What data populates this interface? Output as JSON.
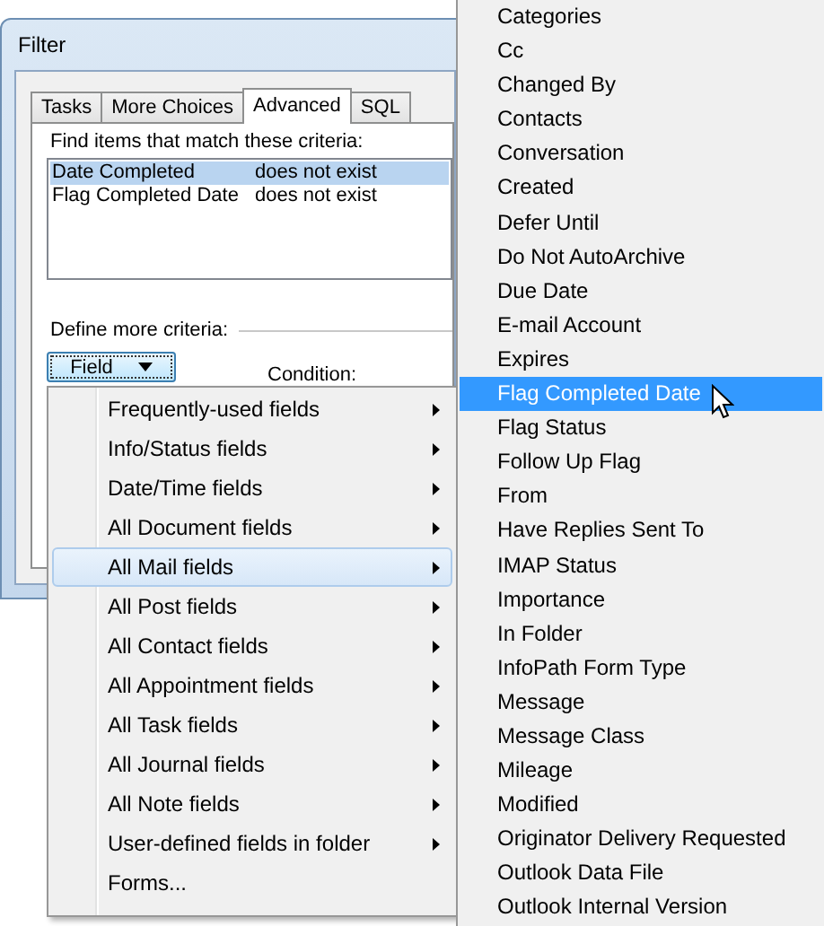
{
  "dialog": {
    "title": "Filter",
    "tabs": [
      {
        "label": "Tasks",
        "selected": false
      },
      {
        "label": "More Choices",
        "selected": false
      },
      {
        "label": "Advanced",
        "selected": true
      },
      {
        "label": "SQL",
        "selected": false
      }
    ],
    "criteria_label": "Find items that match these criteria:",
    "criteria": [
      {
        "field": "Date Completed",
        "condition": "does not exist",
        "selected": true
      },
      {
        "field": "Flag Completed Date",
        "condition": "does not exist",
        "selected": false
      }
    ],
    "define_label": "Define more criteria:",
    "field_button": "Field",
    "condition_label": "Condition:"
  },
  "field_menu": {
    "items": [
      {
        "label": "Frequently-used fields",
        "has_submenu": true,
        "hovered": false
      },
      {
        "label": "Info/Status fields",
        "has_submenu": true,
        "hovered": false
      },
      {
        "label": "Date/Time fields",
        "has_submenu": true,
        "hovered": false
      },
      {
        "label": "All Document fields",
        "has_submenu": true,
        "hovered": false
      },
      {
        "label": "All Mail fields",
        "has_submenu": true,
        "hovered": true
      },
      {
        "label": "All Post fields",
        "has_submenu": true,
        "hovered": false
      },
      {
        "label": "All Contact fields",
        "has_submenu": true,
        "hovered": false
      },
      {
        "label": "All Appointment fields",
        "has_submenu": true,
        "hovered": false
      },
      {
        "label": "All Task fields",
        "has_submenu": true,
        "hovered": false
      },
      {
        "label": "All Journal fields",
        "has_submenu": true,
        "hovered": false
      },
      {
        "label": "All Note fields",
        "has_submenu": true,
        "hovered": false
      },
      {
        "label": "User-defined fields in folder",
        "has_submenu": true,
        "hovered": false
      },
      {
        "label": "Forms...",
        "has_submenu": false,
        "hovered": false
      }
    ]
  },
  "submenu": {
    "items": [
      {
        "label": "Categories",
        "selected": false
      },
      {
        "label": "Cc",
        "selected": false
      },
      {
        "label": "Changed By",
        "selected": false
      },
      {
        "label": "Contacts",
        "selected": false
      },
      {
        "label": "Conversation",
        "selected": false
      },
      {
        "label": "Created",
        "selected": false
      },
      {
        "label": "Defer Until",
        "selected": false
      },
      {
        "label": "Do Not AutoArchive",
        "selected": false
      },
      {
        "label": "Due Date",
        "selected": false
      },
      {
        "label": "E-mail Account",
        "selected": false
      },
      {
        "label": "Expires",
        "selected": false
      },
      {
        "label": "Flag Completed Date",
        "selected": true
      },
      {
        "label": "Flag Status",
        "selected": false
      },
      {
        "label": "Follow Up Flag",
        "selected": false
      },
      {
        "label": "From",
        "selected": false
      },
      {
        "label": "Have Replies Sent To",
        "selected": false
      },
      {
        "label": "IMAP Status",
        "selected": false
      },
      {
        "label": "Importance",
        "selected": false
      },
      {
        "label": "In Folder",
        "selected": false
      },
      {
        "label": "InfoPath Form Type",
        "selected": false
      },
      {
        "label": "Message",
        "selected": false
      },
      {
        "label": "Message Class",
        "selected": false
      },
      {
        "label": "Mileage",
        "selected": false
      },
      {
        "label": "Modified",
        "selected": false
      },
      {
        "label": "Originator Delivery Requested",
        "selected": false
      },
      {
        "label": "Outlook Data File",
        "selected": false
      },
      {
        "label": "Outlook Internal Version",
        "selected": false
      }
    ]
  }
}
